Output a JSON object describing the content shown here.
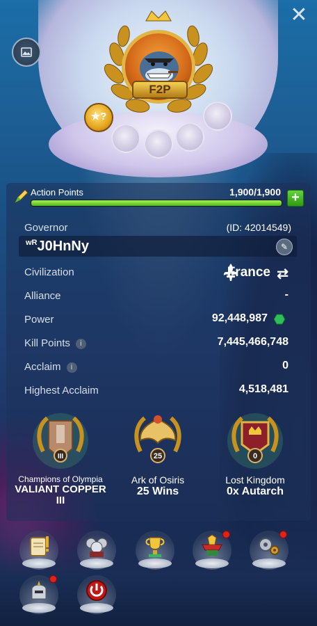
{
  "profile": {
    "badge_text": "F2P",
    "star_slot": "★?"
  },
  "action_points": {
    "label": "Action Points",
    "value": "1,900/1,900",
    "fill_fraction": 1.0
  },
  "governor": {
    "label": "Governor",
    "id": "(ID: 42014549)",
    "name_prefix": "wR",
    "name": "J0HnNy"
  },
  "stats": {
    "civilization_label": "Civilization",
    "civilization_value": "France",
    "alliance_label": "Alliance",
    "alliance_value": "-",
    "power_label": "Power",
    "power_value": "92,448,987",
    "kill_points_label": "Kill Points",
    "kill_points_value": "7,445,466,748",
    "acclaim_label": "Acclaim",
    "acclaim_value": "0",
    "highest_acclaim_label": "Highest Acclaim",
    "highest_acclaim_value": "4,518,481"
  },
  "medals": [
    {
      "title": "Champions of Olympia",
      "sub": "VALIANT COPPER III",
      "emblem": "III"
    },
    {
      "title": "Ark of Osiris",
      "sub": "25 Wins",
      "emblem": "25"
    },
    {
      "title": "Lost Kingdom",
      "sub": "0x Autarch",
      "emblem": "0"
    }
  ],
  "colors": {
    "ap_green": "#63d43a",
    "gold": "#e2b443",
    "badge_red": "#e0231a"
  },
  "bottom_buttons": [
    "scroll-icon",
    "commanders-icon",
    "trophy-icon",
    "banner-icon",
    "settings-gears-icon",
    "helmet-icon",
    "power-icon"
  ]
}
